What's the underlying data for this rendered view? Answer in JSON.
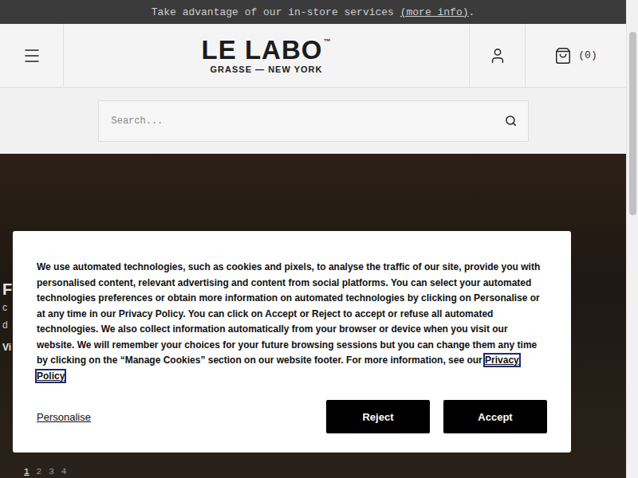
{
  "announcement": {
    "text": "Take advantage of our in-store services ",
    "link": "(more info)",
    "suffix": "."
  },
  "header": {
    "logo": {
      "name": "LE LABO",
      "mark": "™",
      "tagline": "GRASSE — NEW YORK"
    },
    "cart_count": "(0)"
  },
  "search": {
    "placeholder": "Search..."
  },
  "hero": {
    "title": "F",
    "lines": [
      "c",
      "d"
    ],
    "link": "Vi",
    "slides": [
      {
        "label": "1",
        "selected": true
      },
      {
        "label": "2",
        "selected": false
      },
      {
        "label": "3",
        "selected": false
      },
      {
        "label": "4",
        "selected": false
      }
    ]
  },
  "cookie_banner": {
    "text": "We use automated technologies, such as cookies and pixels, to analyse the traffic of our site, provide you with personalised content, relevant advertising and content from social platforms. You can select your automated technologies preferences or obtain more information on automated technologies by clicking on Personalise or at any time in our Privacy Policy. You can click on Accept or Reject to accept or refuse all automated technologies. We also collect information automatically from your browser or device when you visit our website. We will remember your choices for your future browsing sessions but you can change them any time by clicking on the “Manage Cookies” section on our website footer. For more information, see our ",
    "link": "Privacy Policy",
    "personalise": "Personalise",
    "buttons": [
      "Reject",
      "Accept"
    ]
  }
}
